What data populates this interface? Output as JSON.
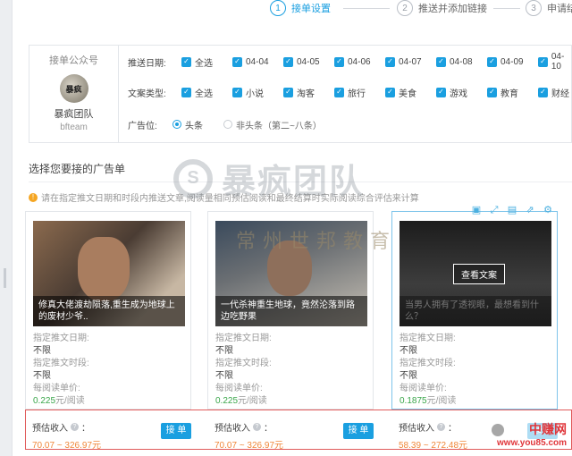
{
  "steps": [
    {
      "num": "1",
      "label": "接单设置",
      "active": true
    },
    {
      "num": "2",
      "label": "推送并添加链接",
      "active": false
    },
    {
      "num": "3",
      "label": "申请结",
      "active": false
    }
  ],
  "account": {
    "title": "接单公众号",
    "logo_text": "暴疯",
    "name": "暴疯团队",
    "id": "bfteam"
  },
  "filters": {
    "date": {
      "label": "推送日期:",
      "options": [
        "全选",
        "04-04",
        "04-05",
        "04-06",
        "04-07",
        "04-08",
        "04-09",
        "04-10"
      ]
    },
    "category": {
      "label": "文案类型:",
      "options": [
        "全选",
        "小说",
        "淘客",
        "旅行",
        "美食",
        "游戏",
        "教育",
        "财经"
      ]
    },
    "position": {
      "label": "广告位:",
      "options": [
        "头条",
        "非头条（第二~八条）"
      ],
      "selected": "头条"
    }
  },
  "section_title": "选择您要接的广告单",
  "notice": "请在指定推文日期和时段内推送文章,阅读量相同预估阅读和最终结算时实际阅读综合评估来计算",
  "watermark": {
    "main": "暴疯团队",
    "icon": "S",
    "secondary": "常州世邦教育"
  },
  "cards": [
    {
      "caption": "修真大佬渡劫陨落,重生成为地球上的废材少爷..",
      "date_label": "指定推文日期:",
      "date_value": "不限",
      "slot_label": "指定推文时段:",
      "slot_value": "不限",
      "price_label": "每阅读单价:",
      "price_value": "0.225",
      "price_unit": "元/阅读",
      "est_label": "预估收入",
      "est_range": "70.07 ~ 326.97元",
      "accept_label": "接 单"
    },
    {
      "caption": "一代杀神重生地球，竟然沦落到路边吃野果",
      "date_label": "指定推文日期:",
      "date_value": "不限",
      "slot_label": "指定推文时段:",
      "slot_value": "不限",
      "price_label": "每阅读单价:",
      "price_value": "0.225",
      "price_unit": "元/阅读",
      "est_label": "预估收入",
      "est_range": "70.07 ~ 326.97元",
      "accept_label": "接 单"
    },
    {
      "caption": "当男人拥有了透视眼，最想看到什么？",
      "view_label": "查看文案",
      "date_label": "指定推文日期:",
      "date_value": "不限",
      "slot_label": "指定推文时段:",
      "slot_value": "不限",
      "price_label": "每阅读单价:",
      "price_value": "0.1875",
      "price_unit": "元/阅读",
      "est_label": "预估收入",
      "est_range": "58.39 ~ 272.48元",
      "accept_label": "接单"
    }
  ],
  "colon": "：",
  "brand": {
    "line1": "中赚网",
    "line2": "www.you85.com"
  },
  "colors": {
    "accent": "#1a9fe0",
    "price": "#3aa64a",
    "estimate": "#f0883a",
    "highlight": "#e05a5a"
  }
}
